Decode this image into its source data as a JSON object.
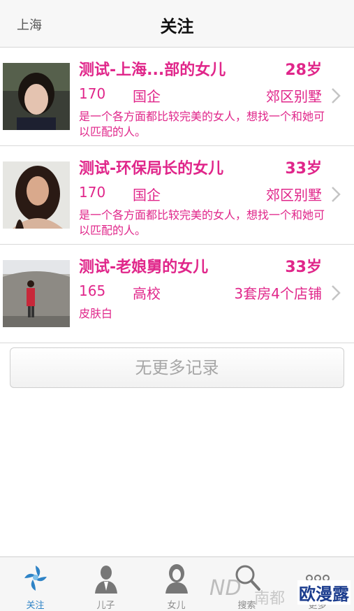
{
  "navbar": {
    "city": "上海",
    "title": "关注"
  },
  "profiles": [
    {
      "name": "测试-上海...部的女儿",
      "age": "28岁",
      "height": "170",
      "job": "国企",
      "assets": "郊区别墅",
      "desc": "是一个各方面都比较完美的女人，想找一个和她可以匹配的人。"
    },
    {
      "name": "测试-环保局长的女儿",
      "age": "33岁",
      "height": "170",
      "job": "国企",
      "assets": "郊区别墅",
      "desc": "是一个各方面都比较完美的女人，想找一个和她可以匹配的人。"
    },
    {
      "name": "测试-老娘舅的女儿",
      "age": "33岁",
      "height": "165",
      "job": "高校",
      "assets": "3套房4个店铺",
      "desc": "皮肤白"
    }
  ],
  "more_button": "无更多记录",
  "tabs": [
    {
      "label": "关注",
      "icon": "follow-icon",
      "active": true
    },
    {
      "label": "儿子",
      "icon": "son-icon",
      "active": false
    },
    {
      "label": "女儿",
      "icon": "daughter-icon",
      "active": false
    },
    {
      "label": "搜索",
      "icon": "search-icon",
      "active": false
    },
    {
      "label": "更多",
      "icon": "more-icon",
      "active": false
    }
  ],
  "watermark": {
    "logo": "ND",
    "city": "南都",
    "brand": "欧漫露"
  },
  "colors": {
    "accent": "#e0268a",
    "tab_active": "#2e83c6"
  }
}
